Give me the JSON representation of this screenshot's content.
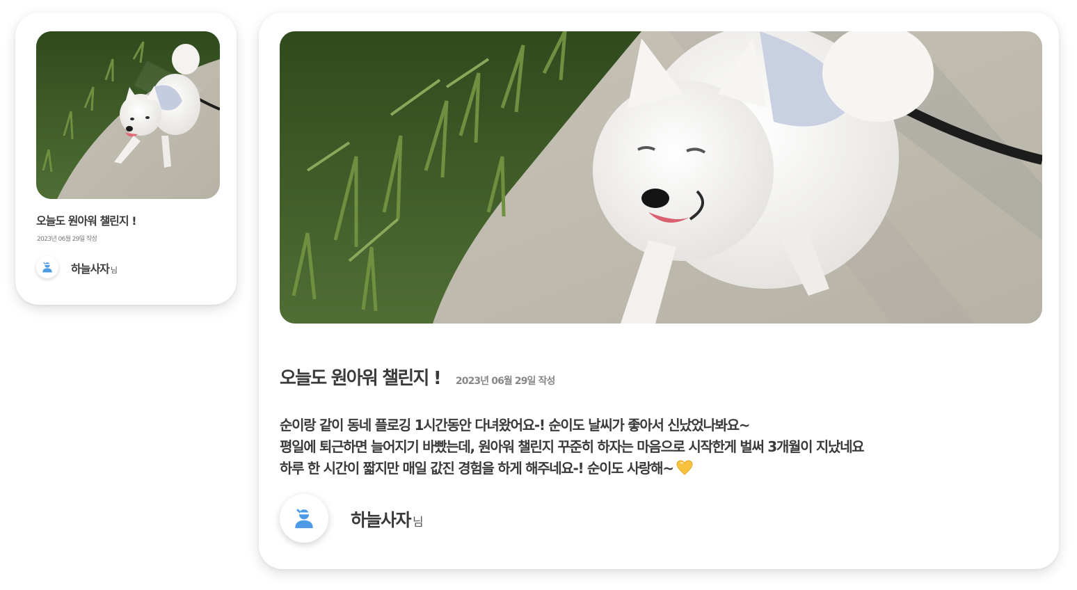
{
  "small_card": {
    "title": "오늘도 원아워 챌린지 !",
    "date": "2023년 06월 29일 작성",
    "author": "하늘사자",
    "author_suffix": "님",
    "photo_icon": "dog-photo-icon",
    "avatar_icon": "user-avatar-icon"
  },
  "detail": {
    "title": "오늘도 원아워 챌린지 !",
    "date": "2023년 06월 29일 작성",
    "body_lines": [
      "순이랑 같이 동네 플로깅 1시간동안 다녀왔어요-! 순이도 날씨가 좋아서 신났었나봐요~",
      "평일에 퇴근하면 늘어지기 바빴는데, 원아워 챌린지 꾸준히 하자는 마음으로 시작한게 벌써 3개월이 지났네요",
      "하루 한 시간이 짧지만 매일 값진 경험을 하게 해주네요-! 순이도 사랑해~"
    ],
    "body_emoji": "yellow-heart-icon",
    "author": "하늘사자",
    "author_suffix": "님",
    "photo_icon": "dog-photo-icon",
    "avatar_icon": "user-avatar-icon"
  },
  "colors": {
    "avatar_blue": "#4d9be6",
    "heart_yellow": "#f7c23e",
    "text_dark": "#3a3a3a",
    "text_muted": "#888888"
  }
}
